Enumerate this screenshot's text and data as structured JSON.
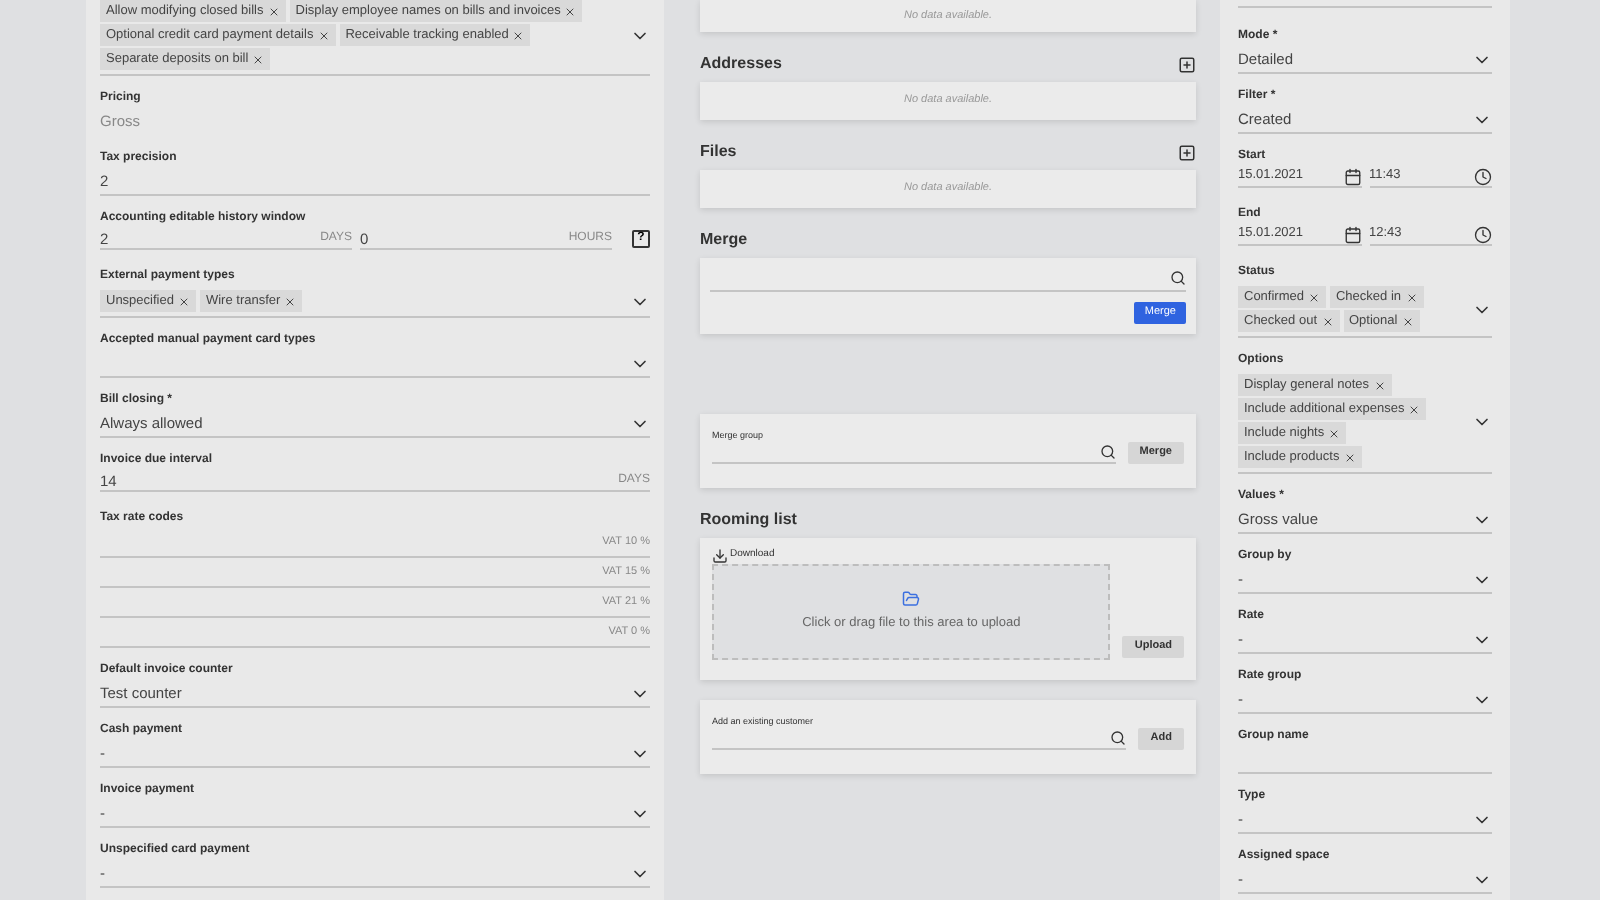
{
  "left_panel": {
    "fields": [
      {
        "kind": "tags",
        "tags": [
          "Allow modifying closed bills",
          "Display employee names on bills and invoices",
          "Optional credit card payment details",
          "Receivable tracking enabled",
          "Separate deposits on bill"
        ]
      },
      {
        "kind": "readonly",
        "label": "Pricing",
        "placeholder": "Gross"
      },
      {
        "kind": "text",
        "label": "Tax precision",
        "value": "2"
      },
      {
        "kind": "history",
        "label": "Accounting editable history window",
        "value": "2",
        "unit": "DAYS",
        "value2": "0",
        "unit2": "HOURS",
        "help": "?"
      },
      {
        "kind": "tags",
        "label": "External payment types",
        "tags": [
          "Unspecified",
          "Wire transfer"
        ]
      },
      {
        "kind": "select",
        "label": "Accepted manual payment card types"
      },
      {
        "kind": "select",
        "label": "Bill closing *",
        "value": "Always allowed"
      },
      {
        "kind": "unit",
        "label": "Invoice due interval",
        "value": "14",
        "unit": "DAYS"
      },
      {
        "kind": "codes",
        "label": "Tax rate codes",
        "codes": [
          "VAT 10 %",
          "VAT 15 %",
          "VAT 21 %",
          "VAT 0 %"
        ]
      },
      {
        "kind": "select",
        "label": "Default invoice counter",
        "value": "Test counter"
      },
      {
        "kind": "select",
        "label": "Cash payment",
        "value": "-"
      },
      {
        "kind": "select",
        "label": "Invoice payment",
        "value": "-"
      },
      {
        "kind": "select",
        "label": "Unspecified card payment",
        "value": "-"
      }
    ]
  },
  "middle": {
    "sections": [
      {
        "kind": "empty",
        "message": "No data available."
      },
      {
        "kind": "empty",
        "title": "Addresses",
        "addable": true,
        "message": "No data available."
      },
      {
        "kind": "empty",
        "title": "Files",
        "addable": true,
        "message": "No data available."
      },
      {
        "kind": "merge",
        "title": "Merge",
        "button": "Merge"
      },
      {
        "kind": "search",
        "label": "Merge group",
        "button": "Merge"
      },
      {
        "kind": "upload",
        "title": "Rooming list",
        "download": "Download",
        "drop_text": "Click or drag file to this area to upload",
        "button": "Upload"
      },
      {
        "kind": "search",
        "label": "Add an existing customer",
        "button": "Add"
      }
    ]
  },
  "right_panel": {
    "fields": [
      {
        "kind": "select",
        "label": "Mode *",
        "value": "Detailed"
      },
      {
        "kind": "select",
        "label": "Filter *",
        "value": "Created"
      },
      {
        "kind": "datetime",
        "label": "Start",
        "date": "15.01.2021",
        "time": "11:43"
      },
      {
        "kind": "datetime",
        "label": "End",
        "date": "15.01.2021",
        "time": "12:43"
      },
      {
        "kind": "tags",
        "label": "Status",
        "tags": [
          "Confirmed",
          "Checked in",
          "Checked out",
          "Optional"
        ]
      },
      {
        "kind": "tags",
        "label": "Options",
        "tags": [
          "Display general notes",
          "Include additional expenses",
          "Include nights",
          "Include products"
        ]
      },
      {
        "kind": "select",
        "label": "Values *",
        "value": "Gross value"
      },
      {
        "kind": "select",
        "label": "Group by",
        "value": "-"
      },
      {
        "kind": "select",
        "label": "Rate",
        "value": "-"
      },
      {
        "kind": "select",
        "label": "Rate group",
        "value": "-"
      },
      {
        "kind": "text",
        "label": "Group name"
      },
      {
        "kind": "select",
        "label": "Type",
        "value": "-"
      },
      {
        "kind": "select",
        "label": "Assigned space",
        "value": "-"
      }
    ]
  }
}
